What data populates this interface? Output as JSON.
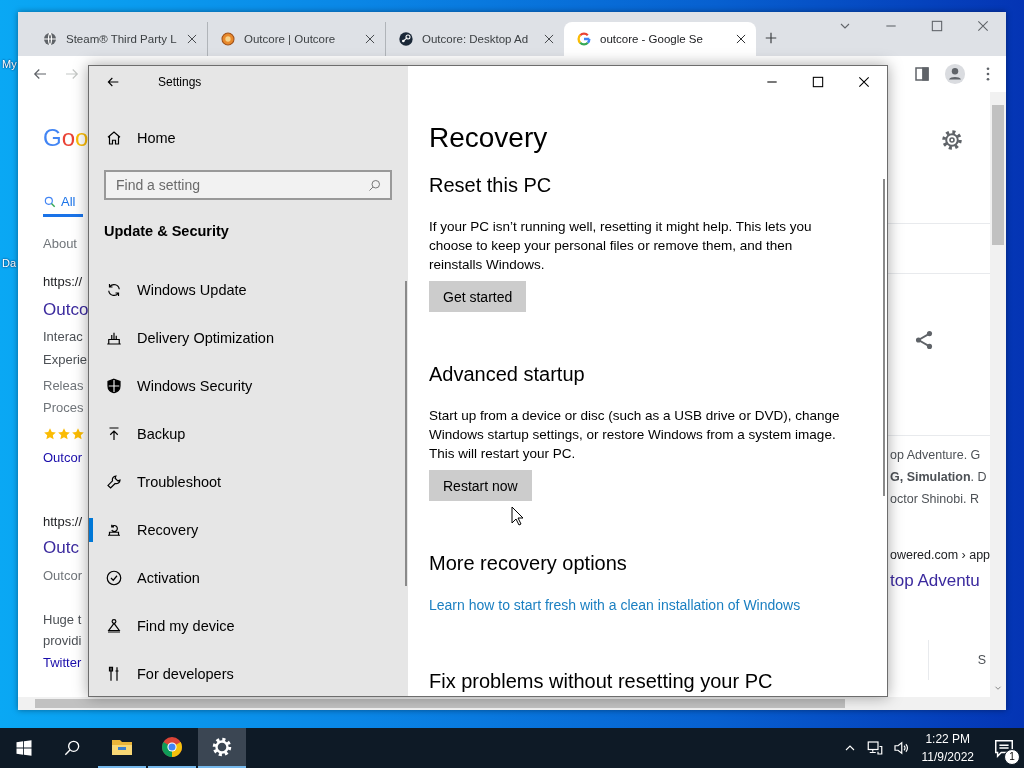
{
  "desktop": {
    "icon_labels": [
      "My",
      "Da"
    ]
  },
  "browser": {
    "tabs": [
      {
        "kind": "globe",
        "title": "Steam® Third Party L",
        "selected": false
      },
      {
        "kind": "emblem",
        "title": "Outcore | Outcore",
        "selected": false
      },
      {
        "kind": "disc",
        "title": "Outcore: Desktop Ad",
        "selected": false
      },
      {
        "kind": "gring",
        "title": "outcore - Google Se",
        "selected": true
      }
    ],
    "nav": [
      {
        "kind": "back",
        "disabled": false
      },
      {
        "kind": "forward",
        "disabled": true
      }
    ],
    "left_column": [
      {
        "kind": "logo",
        "text": "Goo"
      },
      {
        "kind": "tab",
        "text": "All",
        "selected": true
      },
      {
        "kind": "meta",
        "text": "About"
      },
      {
        "kind": "url",
        "text": "https://"
      },
      {
        "kind": "title",
        "text": "Outco"
      },
      {
        "kind": "snippet",
        "text": "Interac"
      },
      {
        "kind": "snippet",
        "text": "Experie"
      },
      {
        "kind": "meta",
        "text": "Releas"
      },
      {
        "kind": "meta",
        "text": "Proces"
      },
      {
        "kind": "stars",
        "stars": 3
      },
      {
        "kind": "link",
        "text": "Outcor"
      },
      {
        "kind": "url",
        "text": "https://"
      },
      {
        "kind": "title",
        "text": "Outc"
      },
      {
        "kind": "meta",
        "text": "Outcor"
      },
      {
        "kind": "snippet",
        "text": "Huge t"
      },
      {
        "kind": "snippet",
        "text": "providi"
      },
      {
        "kind": "link",
        "text": "Twitter"
      }
    ],
    "right_column": [
      {
        "kind": "snippet",
        "text": "op Adventure. G"
      },
      {
        "kind": "snippet",
        "text": "**G, Simulation**. D"
      },
      {
        "kind": "snippet",
        "text": "octor Shinobi. R"
      },
      {
        "kind": "url",
        "text": "owered.com › app"
      },
      {
        "kind": "title",
        "text": "top Adventu"
      },
      {
        "kind": "snippet",
        "text": "S"
      }
    ]
  },
  "settings": {
    "title": "Settings",
    "home": "Home",
    "search": {
      "placeholder": "Find a setting"
    },
    "section": "Update & Security",
    "menu": [
      {
        "kind": "sync",
        "label": "Windows Update",
        "selected": false
      },
      {
        "kind": "delivery",
        "label": "Delivery Optimization",
        "selected": false
      },
      {
        "kind": "shield",
        "label": "Windows Security",
        "selected": false
      },
      {
        "kind": "backup",
        "label": "Backup",
        "selected": false
      },
      {
        "kind": "wrench",
        "label": "Troubleshoot",
        "selected": false
      },
      {
        "kind": "recovery",
        "label": "Recovery",
        "selected": true
      },
      {
        "kind": "activation",
        "label": "Activation",
        "selected": false
      },
      {
        "kind": "find",
        "label": "Find my device",
        "selected": false
      },
      {
        "kind": "developer",
        "label": "For developers",
        "selected": false
      }
    ],
    "page": {
      "title": "Recovery",
      "sections": [
        {
          "heading": "Reset this PC",
          "text": "If your PC isn’t running well, resetting it might help. This lets you choose to keep your personal files or remove them, and then reinstalls Windows.",
          "button": "Get started"
        },
        {
          "heading": "Advanced startup",
          "text": "Start up from a device or disc (such as a USB drive or DVD), change Windows startup settings, or restore Windows from a system image. This will restart your PC.",
          "button": "Restart now"
        },
        {
          "heading": "More recovery options",
          "link": "Learn how to start fresh with a clean installation of Windows"
        },
        {
          "heading": "Fix problems without resetting your PC"
        }
      ]
    }
  },
  "taskbar": {
    "apps": [
      {
        "kind": "explorer",
        "selected": false
      },
      {
        "kind": "chrome",
        "selected": false
      },
      {
        "kind": "settings",
        "selected": true
      }
    ],
    "time": "1:22 PM",
    "date": "11/9/2022",
    "notifications": "1"
  }
}
